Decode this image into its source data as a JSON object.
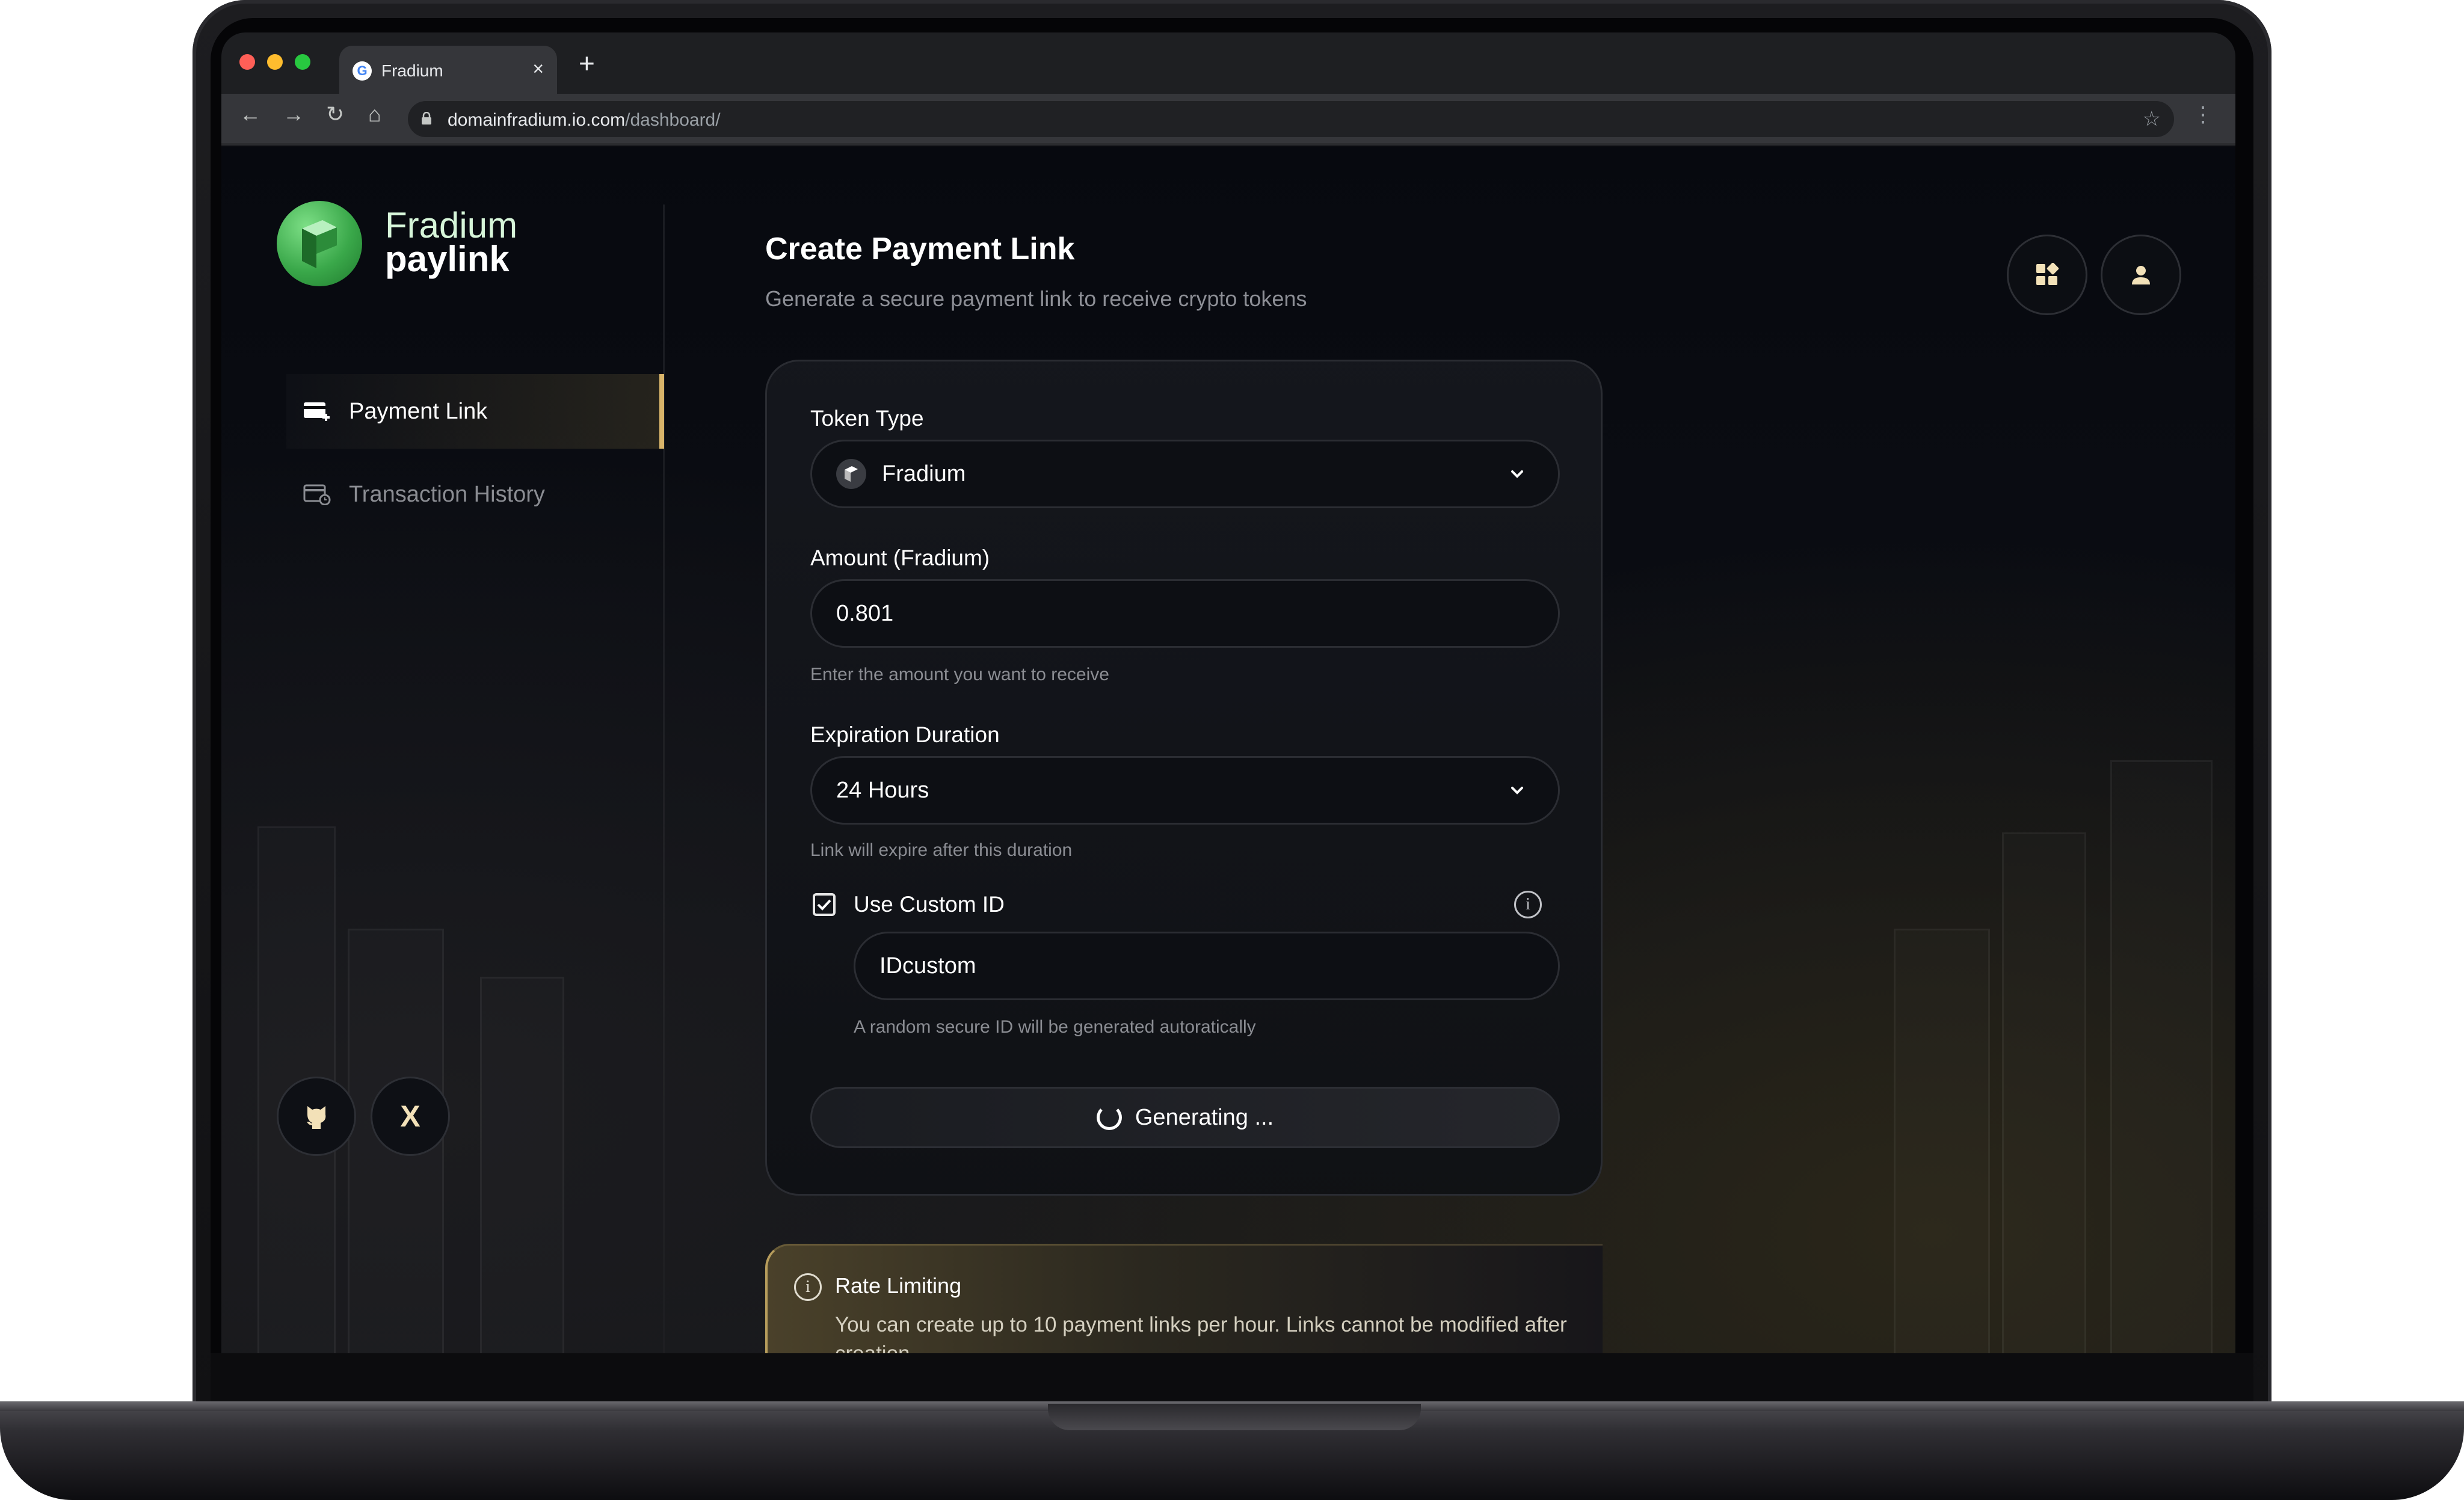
{
  "browser": {
    "tab_title": "Fradium",
    "tab_close": "×",
    "new_tab": "+",
    "url_domain": "domainfradium.io.com",
    "url_path": "/dashboard/"
  },
  "brand": {
    "name_line1": "Fradium",
    "name_line2": "paylink"
  },
  "sidebar": {
    "items": [
      {
        "label": "Payment Link",
        "active": true
      },
      {
        "label": "Transaction History",
        "active": false
      }
    ],
    "social": [
      "github-icon",
      "x-icon"
    ],
    "x_glyph": "X"
  },
  "header": {
    "title": "Create Payment Link",
    "subtitle": "Generate a secure payment link to receive crypto tokens"
  },
  "form": {
    "token_type": {
      "label": "Token Type",
      "value": "Fradium"
    },
    "amount": {
      "label": "Amount (Fradium)",
      "value": "0.801",
      "hint": "Enter the amount you want to receive"
    },
    "expiration": {
      "label": "Expiration Duration",
      "value": "24 Hours",
      "hint": "Link will expire after this duration"
    },
    "custom_id": {
      "label": "Use Custom ID",
      "checked": true,
      "value": "IDcustom",
      "hint": "A random secure ID will be generated autoratically",
      "info_glyph": "i"
    },
    "submit_label": "Generating ..."
  },
  "notice": {
    "glyph": "i",
    "title": "Rate Limiting",
    "text": "You can create up to 10 payment links per hour. Links cannot be modified after creation."
  },
  "colors": {
    "accent": "#d8b46a",
    "brand_green": "#3aa84a",
    "background": "#0a0b10"
  }
}
